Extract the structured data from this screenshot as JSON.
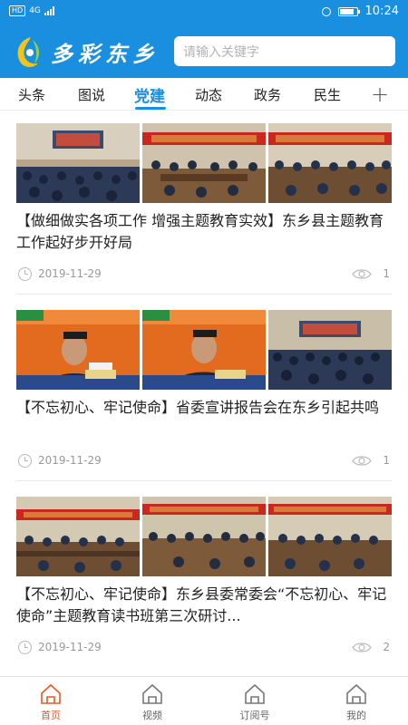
{
  "status_bar": {
    "network": "HD",
    "signal": "4G",
    "time": "10:24",
    "battery_level": 0.85
  },
  "header": {
    "brand": "多彩东乡",
    "search_placeholder": "请输入关键字"
  },
  "tabs": [
    {
      "label": "头条",
      "active": false
    },
    {
      "label": "图说",
      "active": false
    },
    {
      "label": "党建",
      "active": true
    },
    {
      "label": "动态",
      "active": false
    },
    {
      "label": "政务",
      "active": false
    },
    {
      "label": "民生",
      "active": false
    }
  ],
  "add_tab_icon": "plus-icon",
  "articles": [
    {
      "title": "【做细做实各项工作 增强主题教育实效】东乡县主题教育工作起好步开好局",
      "date": "2019-11-29",
      "views": "1",
      "images": [
        "meeting-hall-photo",
        "meeting-hall-photo",
        "meeting-hall-photo"
      ]
    },
    {
      "title": "【不忘初心、牢记使命】省委宣讲报告会在东乡引起共鸣",
      "date": "2019-11-29",
      "views": "1",
      "images": [
        "speaker-tv-photo",
        "speaker-tv-photo",
        "meeting-hall-photo"
      ]
    },
    {
      "title": "【不忘初心、牢记使命】东乡县委常委会“不忘初心、牢记使命”主题教育读书班第三次研讨...",
      "date": "2019-11-29",
      "views": "2",
      "images": [
        "meeting-hall-photo",
        "meeting-hall-photo",
        "meeting-hall-photo"
      ]
    }
  ],
  "bottom_nav": [
    {
      "label": "首页",
      "icon": "home-icon",
      "active": true
    },
    {
      "label": "视频",
      "icon": "video-icon",
      "active": false
    },
    {
      "label": "订阅号",
      "icon": "subscribe-icon",
      "active": false
    },
    {
      "label": "我的",
      "icon": "profile-icon",
      "active": false
    }
  ],
  "colors": {
    "brand_blue": "#1a8fe0",
    "active_nav": "#e05a23",
    "banner_red": "#c8281e"
  }
}
